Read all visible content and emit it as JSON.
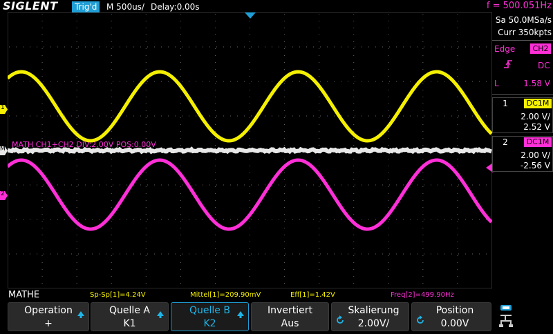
{
  "header": {
    "brand": "SIGLENT",
    "trigger_status": "Trig'd",
    "timebase": "M 500us/",
    "delay": "Delay:0.00s",
    "frequency": "f = 500.051Hz"
  },
  "acquisition": {
    "sample_rate": "Sa 50.0MSa/s",
    "memory_depth": "Curr 350kpts"
  },
  "trigger": {
    "type": "Edge",
    "source": "CH2",
    "coupling": "DC",
    "level_label": "L",
    "level": "1.58 V"
  },
  "channels": [
    {
      "number": "1",
      "coupling": "DC1M",
      "scale": "2.00 V/",
      "offset": "2.52 V",
      "color": "#f5f000"
    },
    {
      "number": "2",
      "coupling": "DC1M",
      "scale": "2.00 V/",
      "offset": "-2.56 V",
      "color": "#ff2fd8"
    }
  ],
  "markers": {
    "ch1": "1",
    "ch2": "2",
    "math": "M"
  },
  "math_label": "MATH  CH1+CH2  DIV:2.00V  POS:0.00V",
  "menu_title": "MATHE",
  "measurements": [
    {
      "text": "Sp-Sp[1]=4.24V",
      "color": "#f5f000"
    },
    {
      "text": "Mittel[1]=209.90mV",
      "color": "#f5f000"
    },
    {
      "text": "Eff[1]=1.42V",
      "color": "#f5f000"
    },
    {
      "text": "Freq[2]=499.90Hz",
      "color": "#ff2fd8"
    }
  ],
  "softkeys": [
    {
      "label": "Operation",
      "value": "+"
    },
    {
      "label": "Quelle A",
      "value": "K1"
    },
    {
      "label": "Quelle B",
      "value": "K2"
    },
    {
      "label": "Invertiert",
      "value": "Aus"
    },
    {
      "label": "Skalierung",
      "value": "2.00V/"
    },
    {
      "label": "Position",
      "value": "0.00V"
    }
  ],
  "waveforms": {
    "frequency_hz": 500,
    "time_per_div_s": 0.0005,
    "ch1_color": "#f5f000",
    "ch2_color": "#ff2fd8",
    "math_color": "#e8e8e8"
  }
}
